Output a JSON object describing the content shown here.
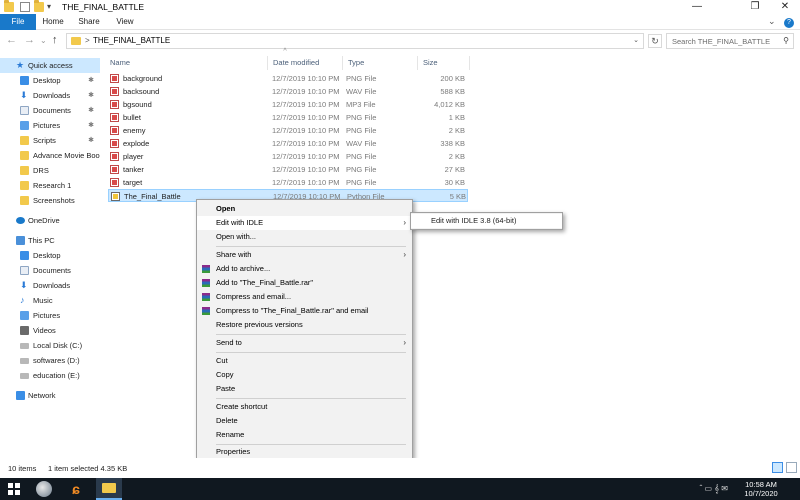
{
  "window": {
    "title": "THE_FINAL_BATTLE",
    "minimize_glyph": "—",
    "maximize_glyph": "❐",
    "close_glyph": "✕"
  },
  "ribbon": {
    "tabs": [
      "File",
      "Home",
      "Share",
      "View"
    ],
    "expand_glyph": "⌄",
    "help_glyph": "?"
  },
  "address": {
    "back_glyph": "←",
    "forward_glyph": "→",
    "recent_glyph": "⌄",
    "up_glyph": "↑",
    "path": "THE_FINAL_BATTLE",
    "chevron": ">",
    "dropdown_glyph": "⌄",
    "refresh_glyph": "↻",
    "search_placeholder": "Search THE_FINAL_BATTLE",
    "search_glyph": "⚲"
  },
  "nav": {
    "quick_access": "Quick access",
    "qa_items": [
      "Desktop",
      "Downloads",
      "Documents",
      "Pictures",
      "Scripts",
      "Advance Movie Boo",
      "DRS",
      "Research 1",
      "Screenshots"
    ],
    "onedrive": "OneDrive",
    "this_pc": "This PC",
    "pc_items": [
      "Desktop",
      "Documents",
      "Downloads",
      "Music",
      "Pictures",
      "Videos",
      "Local Disk (C:)",
      "softwares (D:)",
      "education (E:)"
    ],
    "network": "Network",
    "pin_glyph": "✱"
  },
  "columns": {
    "name": "Name",
    "date": "Date modified",
    "type": "Type",
    "size": "Size",
    "sort_glyph": "^"
  },
  "files": [
    {
      "name": "background",
      "date": "12/7/2019 10:10 PM",
      "type": "PNG File",
      "size": "200 KB"
    },
    {
      "name": "backsound",
      "date": "12/7/2019 10:10 PM",
      "type": "WAV File",
      "size": "588 KB"
    },
    {
      "name": "bgsound",
      "date": "12/7/2019 10:10 PM",
      "type": "MP3 File",
      "size": "4,012 KB"
    },
    {
      "name": "bullet",
      "date": "12/7/2019 10:10 PM",
      "type": "PNG File",
      "size": "1 KB"
    },
    {
      "name": "enemy",
      "date": "12/7/2019 10:10 PM",
      "type": "PNG File",
      "size": "2 KB"
    },
    {
      "name": "explode",
      "date": "12/7/2019 10:10 PM",
      "type": "WAV File",
      "size": "338 KB"
    },
    {
      "name": "player",
      "date": "12/7/2019 10:10 PM",
      "type": "PNG File",
      "size": "2 KB"
    },
    {
      "name": "tanker",
      "date": "12/7/2019 10:10 PM",
      "type": "PNG File",
      "size": "27 KB"
    },
    {
      "name": "target",
      "date": "12/7/2019 10:10 PM",
      "type": "PNG File",
      "size": "30 KB"
    },
    {
      "name": "The_Final_Battle",
      "date": "12/7/2019 10:10 PM",
      "type": "Python File",
      "size": "5 KB"
    }
  ],
  "context_menu": {
    "open": "Open",
    "edit_with_idle": "Edit with IDLE",
    "open_with": "Open with...",
    "share_with": "Share with",
    "add_to_archive": "Add to archive...",
    "add_to_rar": "Add to \"The_Final_Battle.rar\"",
    "compress_email": "Compress and email...",
    "compress_rar_email": "Compress to \"The_Final_Battle.rar\" and email",
    "restore_versions": "Restore previous versions",
    "send_to": "Send to",
    "cut": "Cut",
    "copy": "Copy",
    "paste": "Paste",
    "create_shortcut": "Create shortcut",
    "delete": "Delete",
    "rename": "Rename",
    "properties": "Properties",
    "arrow_glyph": "›"
  },
  "submenu": {
    "item": "Edit with IDLE 3.8 (64-bit)"
  },
  "status": {
    "items": "10 items",
    "selected": "1 item selected  4.35 KB"
  },
  "taskbar": {
    "app2_glyph": "ɕ",
    "tray_glyphs": "ˆ ▭ 𝄞 ✉",
    "time": "10:58 AM",
    "date": "10/7/2020"
  }
}
